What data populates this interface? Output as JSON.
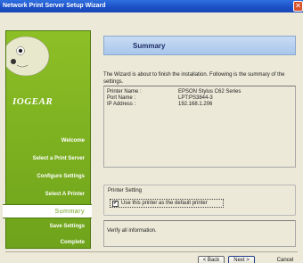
{
  "window": {
    "title": "Network Print Server Setup Wizard",
    "close_icon": "close-icon",
    "close_glyph": "✕"
  },
  "sidebar": {
    "brand": "IOGEAR",
    "steps": [
      {
        "label": "Welcome",
        "active": false
      },
      {
        "label": "Select a Print Server",
        "active": false
      },
      {
        "label": "Configure Settings",
        "active": false
      },
      {
        "label": "Select A Printer",
        "active": false
      },
      {
        "label": "Summary",
        "active": true
      },
      {
        "label": "Save Settings",
        "active": false
      },
      {
        "label": "Complete",
        "active": false
      }
    ]
  },
  "content": {
    "heading": "Summary",
    "intro": "The Wizard is about to finish the installation. Following is the summary of the settings.",
    "summary": [
      {
        "label": "Printer Name :",
        "value": "EPSON Stylus C62 Series"
      },
      {
        "label": "Port Name :",
        "value": "LPT:PS3844-3"
      },
      {
        "label": "IP Address :",
        "value": "192.168.1.206"
      }
    ],
    "printer_setting": {
      "legend": "Printer Setting",
      "checkbox_label": "Use this printer as the default printer",
      "checked": true,
      "check_glyph": "✔"
    },
    "info": "Verify all information."
  },
  "buttons": {
    "back": "< Back",
    "next": "Next >",
    "cancel": "Cancel"
  },
  "colors": {
    "sidebar_green": "#7ab020",
    "titlebar_blue": "#1b4fc6",
    "heading_blue": "#b9d2f0"
  }
}
